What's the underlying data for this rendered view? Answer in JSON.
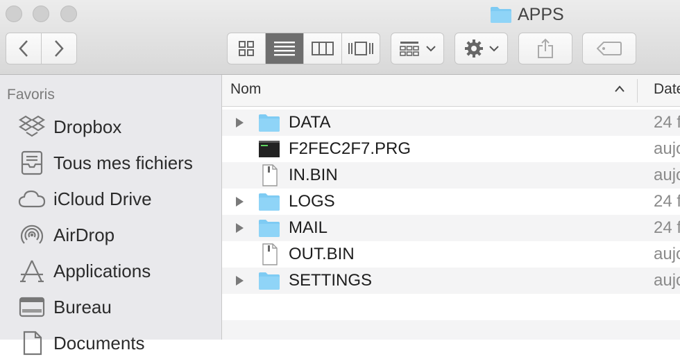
{
  "window": {
    "title": "APPS",
    "traffic_lights": [
      "close",
      "minimize",
      "zoom"
    ]
  },
  "toolbar": {
    "back_icon": "chevron-left-icon",
    "forward_icon": "chevron-right-icon",
    "view_modes": [
      "icon-view",
      "list-view",
      "column-view",
      "cover-flow-view"
    ],
    "active_view": "list-view",
    "group_icon": "group-icon",
    "action_icon": "gear-icon",
    "share_icon": "share-icon",
    "tag_icon": "tag-icon"
  },
  "sidebar": {
    "heading": "Favoris",
    "items": [
      {
        "label": "Dropbox",
        "icon": "dropbox-icon"
      },
      {
        "label": "Tous mes fichiers",
        "icon": "all-files-icon"
      },
      {
        "label": "iCloud Drive",
        "icon": "cloud-icon"
      },
      {
        "label": "AirDrop",
        "icon": "airdrop-icon"
      },
      {
        "label": "Applications",
        "icon": "applications-icon"
      },
      {
        "label": "Bureau",
        "icon": "desktop-icon"
      },
      {
        "label": "Documents",
        "icon": "documents-icon"
      }
    ]
  },
  "list": {
    "columns": {
      "name": "Nom",
      "date": "Date"
    },
    "rows": [
      {
        "name": "DATA",
        "date": "24 f",
        "kind": "folder",
        "expandable": true
      },
      {
        "name": "F2FEC2F7.PRG",
        "date": "aujo",
        "kind": "executable",
        "expandable": false
      },
      {
        "name": "IN.BIN",
        "date": "aujo",
        "kind": "file",
        "expandable": false
      },
      {
        "name": "LOGS",
        "date": "24 f",
        "kind": "folder",
        "expandable": true
      },
      {
        "name": "MAIL",
        "date": "24 f",
        "kind": "folder",
        "expandable": true
      },
      {
        "name": "OUT.BIN",
        "date": "aujo",
        "kind": "file",
        "expandable": false
      },
      {
        "name": "SETTINGS",
        "date": "aujo",
        "kind": "folder",
        "expandable": true
      }
    ]
  },
  "colors": {
    "folder": "#7ecbf3",
    "active_segment": "#6e6e6e",
    "sidebar_bg": "#e9e9ec"
  }
}
